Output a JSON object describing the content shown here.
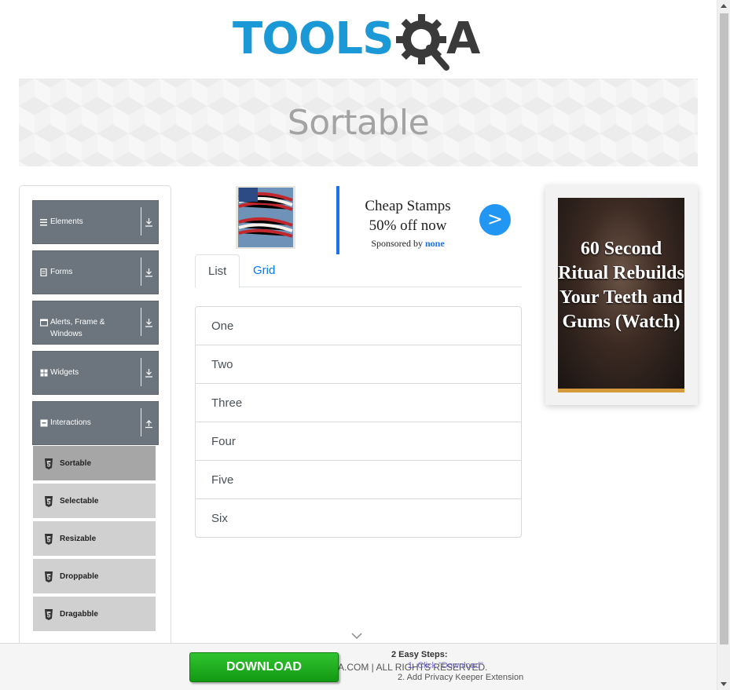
{
  "brand": {
    "logo_text": "TOOLS",
    "logo_suffix": "A",
    "logo_icon": "gear-magnifier-icon",
    "primary_color": "#1b98d6"
  },
  "banner": {
    "title": "Sortable"
  },
  "sidebar": {
    "groups": [
      {
        "label": "Elements",
        "icon": "hamburger-icon",
        "arrow": "download-arrow-icon"
      },
      {
        "label": "Forms",
        "icon": "form-icon",
        "arrow": "download-arrow-icon"
      },
      {
        "label": "Alerts, Frame &",
        "label2": "Windows",
        "icon": "window-icon",
        "arrow": "download-arrow-icon"
      },
      {
        "label": "Widgets",
        "icon": "grid-icon",
        "arrow": "download-arrow-icon"
      },
      {
        "label": "Interactions",
        "icon": "interaction-icon",
        "arrow": "upload-arrow-icon"
      }
    ],
    "items": [
      {
        "label": "Sortable",
        "icon": "html5-icon",
        "active": true
      },
      {
        "label": "Selectable",
        "icon": "html5-icon"
      },
      {
        "label": "Resizable",
        "icon": "html5-icon"
      },
      {
        "label": "Droppable",
        "icon": "html5-icon"
      },
      {
        "label": "Dragabble",
        "icon": "html5-icon"
      }
    ]
  },
  "ad_top": {
    "title_line1": "Cheap Stamps",
    "title_line2": "50% off now",
    "sponsored_prefix": "Sponsored by",
    "sponsor": "none",
    "go": ">"
  },
  "tabs": [
    {
      "label": "List",
      "active": true
    },
    {
      "label": "Grid"
    }
  ],
  "list": [
    "One",
    "Two",
    "Three",
    "Four",
    "Five",
    "Six"
  ],
  "ad_right": {
    "text": "60 Second Ritual Rebuilds Your Teeth and Gums (Watch)"
  },
  "download_bar": {
    "button": "DOWNLOAD",
    "footer": "A.COM | ALL RIGHTS RESERVED.",
    "steps_title": "2 Easy Steps:",
    "step1": "1. Click \"Download\"",
    "step2": "2. Add Privacy Keeper Extension"
  }
}
